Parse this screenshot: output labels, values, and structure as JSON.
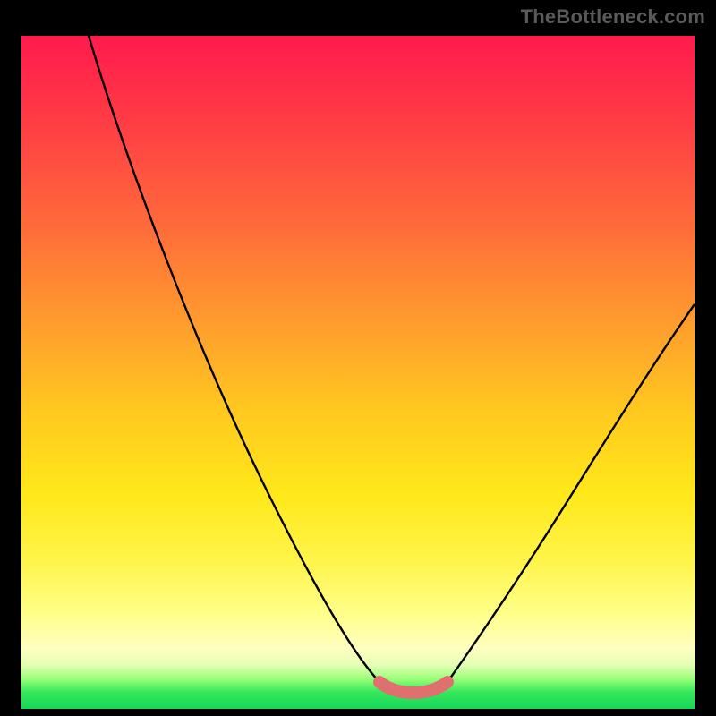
{
  "watermark": {
    "text": "TheBottleneck.com"
  },
  "chart_data": {
    "type": "line",
    "title": "",
    "xlabel": "",
    "ylabel": "",
    "xlim": [
      0,
      100
    ],
    "ylim": [
      0,
      100
    ],
    "grid": false,
    "legend": false,
    "series": [
      {
        "name": "left-curve",
        "color": "#000000",
        "x": [
          10,
          15,
          20,
          25,
          30,
          35,
          40,
          45,
          50,
          53
        ],
        "y": [
          100,
          88,
          76,
          64,
          52,
          40,
          28,
          16,
          6,
          4
        ]
      },
      {
        "name": "right-curve",
        "color": "#000000",
        "x": [
          63,
          66,
          70,
          75,
          80,
          85,
          90,
          95,
          100
        ],
        "y": [
          4,
          6,
          12,
          20,
          28,
          36,
          44,
          52,
          60
        ]
      },
      {
        "name": "trough",
        "color": "#e07070",
        "x": [
          53,
          55,
          58,
          61,
          63
        ],
        "y": [
          4,
          3.2,
          3,
          3.2,
          4
        ]
      }
    ],
    "background_gradient": {
      "top": "#ff1a4d",
      "mid": "#ffe81a",
      "bottom": "#17d65a"
    }
  }
}
